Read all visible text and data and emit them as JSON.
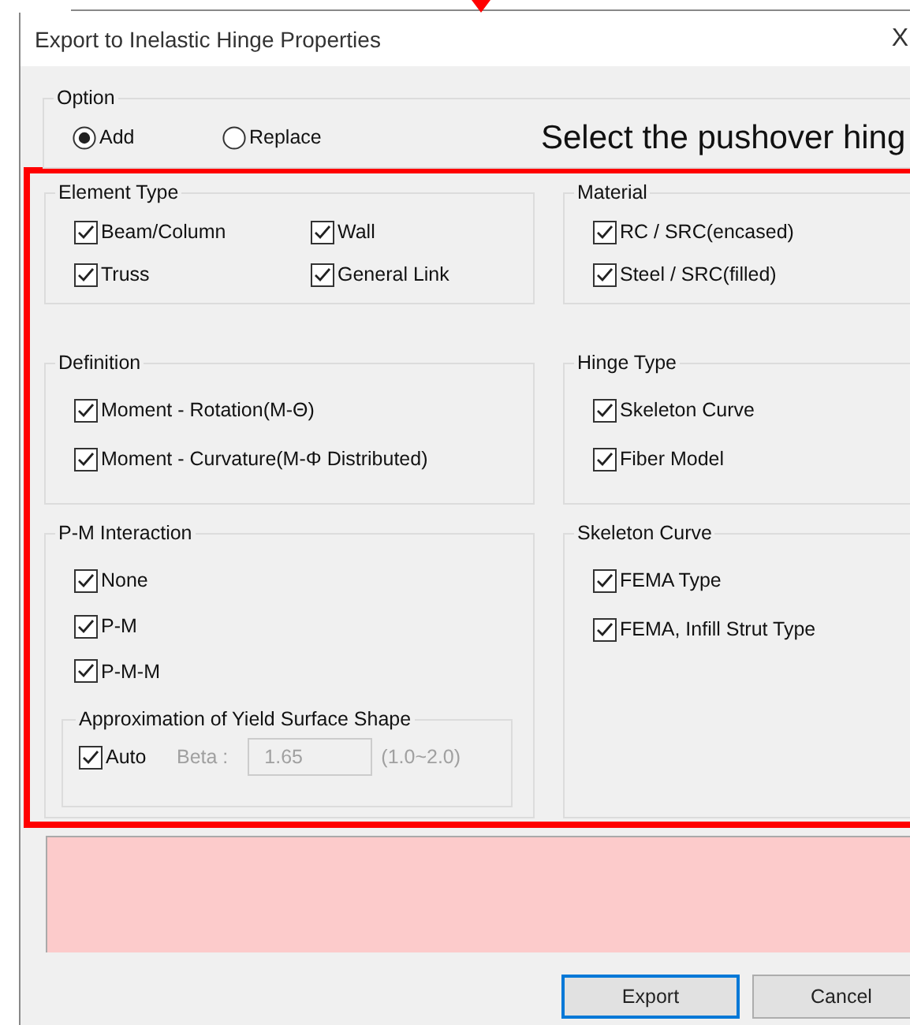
{
  "window": {
    "title": "Export to Inelastic Hinge Properties",
    "close": "X"
  },
  "option": {
    "title": "Option",
    "radios": [
      {
        "label": "Add",
        "selected": true
      },
      {
        "label": "Replace",
        "selected": false
      }
    ]
  },
  "annotation": "Select the pushover hing",
  "left_groups": [
    {
      "title": "Element Type",
      "kind": "grid",
      "items": [
        {
          "label": "Beam/Column",
          "checked": true
        },
        {
          "label": "Wall",
          "checked": true
        },
        {
          "label": "Truss",
          "checked": true
        },
        {
          "label": "General Link",
          "checked": true
        }
      ]
    },
    {
      "title": "Definition",
      "kind": "list",
      "items": [
        {
          "label": "Moment - Rotation(M-Θ)",
          "checked": true
        },
        {
          "label": "Moment - Curvature(M-Φ Distributed)",
          "checked": true
        }
      ]
    },
    {
      "title": "P-M Interaction",
      "kind": "list",
      "items": [
        {
          "label": "None",
          "checked": true
        },
        {
          "label": "P-M",
          "checked": true
        },
        {
          "label": "P-M-M",
          "checked": true
        }
      ],
      "approximation": {
        "title": "Approximation of Yield Surface Shape",
        "auto": {
          "label": "Auto",
          "checked": true
        },
        "beta": {
          "label": "Beta :",
          "value": "1.65",
          "disabled": true
        },
        "range": "(1.0~2.0)"
      }
    }
  ],
  "right_groups": [
    {
      "title": "Material",
      "kind": "list",
      "items": [
        {
          "label": "RC / SRC(encased)",
          "checked": true
        },
        {
          "label": "Steel / SRC(filled)",
          "checked": true
        }
      ]
    },
    {
      "title": "Hinge Type",
      "kind": "list",
      "items": [
        {
          "label": "Skeleton Curve",
          "checked": true
        },
        {
          "label": "Fiber Model",
          "checked": true
        }
      ]
    },
    {
      "title": "Skeleton Curve",
      "kind": "list",
      "items": [
        {
          "label": "FEMA Type",
          "checked": true
        },
        {
          "label": "FEMA, Infill Strut Type",
          "checked": true
        }
      ]
    }
  ],
  "buttons": [
    {
      "label": "Export",
      "default": true
    },
    {
      "label": "Cancel",
      "default": false
    }
  ]
}
